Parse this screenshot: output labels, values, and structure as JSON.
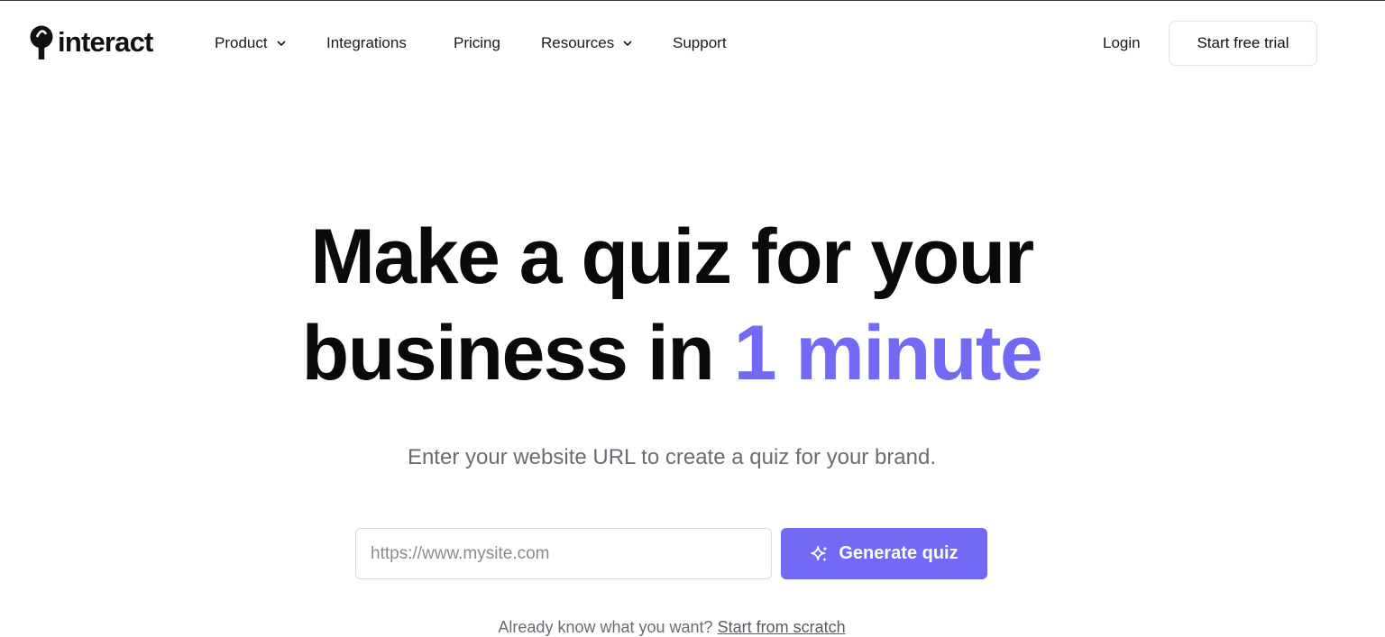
{
  "brand": {
    "name": "interact",
    "icon": "interact-logo-mark-icon",
    "accent_color": "#7269f5"
  },
  "nav": {
    "items": [
      {
        "label": "Product",
        "has_dropdown": true
      },
      {
        "label": "Integrations",
        "has_dropdown": false
      },
      {
        "label": "Pricing",
        "has_dropdown": false
      },
      {
        "label": "Resources",
        "has_dropdown": true
      },
      {
        "label": "Support",
        "has_dropdown": false
      }
    ],
    "login_label": "Login",
    "trial_label": "Start free trial"
  },
  "hero": {
    "title_line1": "Make a quiz for your",
    "title_line2_prefix": "business in",
    "title_accent": "1 minute",
    "subtitle": "Enter your website URL to create a quiz for your brand.",
    "url_placeholder": "https://www.mysite.com",
    "generate_label": "Generate quiz",
    "generate_icon": "sparkle-icon",
    "scratch_prompt": "Already know what you want?",
    "scratch_link": "Start from scratch"
  }
}
